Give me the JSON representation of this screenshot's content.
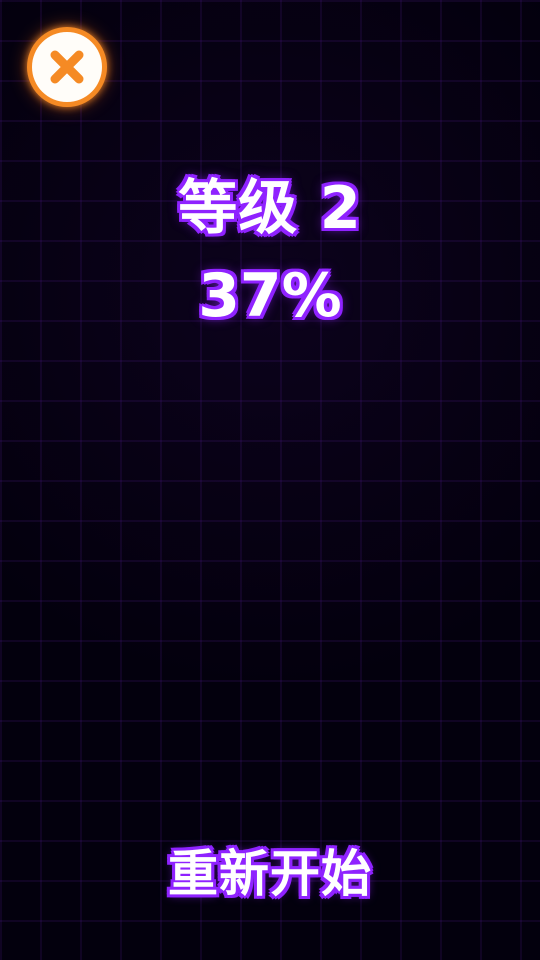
{
  "theme": {
    "background": "#03000d",
    "grid": "#5c20aa",
    "text": "#ffffff",
    "text_glow": "#8f22ff",
    "accent": "#f58a24",
    "icon_bg": "#fffdf9"
  },
  "header": {
    "close_icon": "close-icon"
  },
  "level": {
    "title": "等级 2",
    "progress_text": "37%",
    "progress_value": 0.37
  },
  "footer": {
    "restart_label": "重新开始"
  }
}
